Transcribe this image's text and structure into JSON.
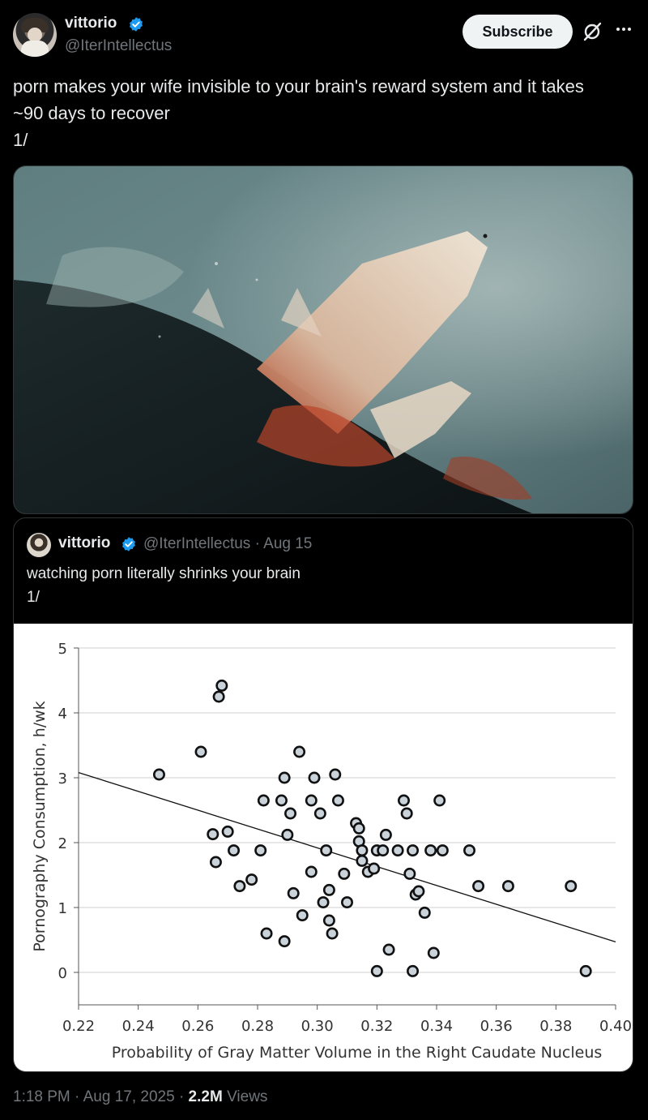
{
  "author": {
    "name": "vittorio",
    "handle": "@IterIntellectus"
  },
  "actions": {
    "subscribe_label": "Subscribe"
  },
  "tweet": {
    "text": "porn makes your wife invisible to your brain's reward system and it takes\n~90 days to recover\n1/"
  },
  "quote": {
    "name": "vittorio",
    "handle": "@IterIntellectus",
    "separator": "·",
    "date": "Aug 15",
    "text": "watching porn literally shrinks your brain\n1/"
  },
  "footer": {
    "time": "1:18 PM",
    "date": "Aug 17, 2025",
    "views_count": "2.2M",
    "views_label": "Views"
  },
  "colors": {
    "verified": "#1d9bf0",
    "marker_fill": "#c9d3d9"
  },
  "icons": [
    "verified-badge-icon",
    "grok-icon",
    "more-icon"
  ],
  "chart_data": {
    "type": "scatter",
    "title": "",
    "xlabel": "Probability of Gray Matter Volume in the Right Caudate Nucleus",
    "ylabel": "Pornography Consumption, h/wk",
    "xlim": [
      0.22,
      0.4
    ],
    "ylim": [
      -0.5,
      5
    ],
    "x_ticks": [
      "0.22",
      "0.24",
      "0.26",
      "0.28",
      "0.30",
      "0.32",
      "0.34",
      "0.36",
      "0.38",
      "0.40"
    ],
    "y_ticks": [
      "0",
      "1",
      "2",
      "3",
      "4",
      "5"
    ],
    "grid": "horizontal",
    "trendline": {
      "x": [
        0.22,
        0.4
      ],
      "y": [
        3.08,
        0.47
      ]
    },
    "points": [
      {
        "x": 0.247,
        "y": 3.05
      },
      {
        "x": 0.261,
        "y": 3.4
      },
      {
        "x": 0.267,
        "y": 4.25
      },
      {
        "x": 0.268,
        "y": 4.42
      },
      {
        "x": 0.265,
        "y": 2.13
      },
      {
        "x": 0.266,
        "y": 1.7
      },
      {
        "x": 0.27,
        "y": 2.17
      },
      {
        "x": 0.272,
        "y": 1.88
      },
      {
        "x": 0.274,
        "y": 1.33
      },
      {
        "x": 0.278,
        "y": 1.43
      },
      {
        "x": 0.281,
        "y": 1.88
      },
      {
        "x": 0.282,
        "y": 2.65
      },
      {
        "x": 0.283,
        "y": 0.6
      },
      {
        "x": 0.288,
        "y": 2.65
      },
      {
        "x": 0.289,
        "y": 3.0
      },
      {
        "x": 0.29,
        "y": 2.12
      },
      {
        "x": 0.289,
        "y": 0.48
      },
      {
        "x": 0.291,
        "y": 2.45
      },
      {
        "x": 0.292,
        "y": 1.22
      },
      {
        "x": 0.294,
        "y": 3.4
      },
      {
        "x": 0.295,
        "y": 0.88
      },
      {
        "x": 0.298,
        "y": 2.65
      },
      {
        "x": 0.298,
        "y": 1.55
      },
      {
        "x": 0.299,
        "y": 3.0
      },
      {
        "x": 0.301,
        "y": 2.45
      },
      {
        "x": 0.302,
        "y": 1.08
      },
      {
        "x": 0.303,
        "y": 1.88
      },
      {
        "x": 0.304,
        "y": 0.8
      },
      {
        "x": 0.304,
        "y": 1.27
      },
      {
        "x": 0.305,
        "y": 0.6
      },
      {
        "x": 0.306,
        "y": 3.05
      },
      {
        "x": 0.307,
        "y": 2.65
      },
      {
        "x": 0.309,
        "y": 1.52
      },
      {
        "x": 0.31,
        "y": 1.08
      },
      {
        "x": 0.313,
        "y": 2.3
      },
      {
        "x": 0.314,
        "y": 2.22
      },
      {
        "x": 0.314,
        "y": 2.02
      },
      {
        "x": 0.315,
        "y": 1.88
      },
      {
        "x": 0.315,
        "y": 1.72
      },
      {
        "x": 0.317,
        "y": 1.55
      },
      {
        "x": 0.319,
        "y": 1.6
      },
      {
        "x": 0.32,
        "y": 1.88
      },
      {
        "x": 0.322,
        "y": 1.88
      },
      {
        "x": 0.323,
        "y": 2.12
      },
      {
        "x": 0.32,
        "y": 0.02
      },
      {
        "x": 0.324,
        "y": 0.35
      },
      {
        "x": 0.327,
        "y": 1.88
      },
      {
        "x": 0.329,
        "y": 2.65
      },
      {
        "x": 0.33,
        "y": 2.45
      },
      {
        "x": 0.331,
        "y": 1.52
      },
      {
        "x": 0.332,
        "y": 1.88
      },
      {
        "x": 0.333,
        "y": 1.2
      },
      {
        "x": 0.334,
        "y": 1.25
      },
      {
        "x": 0.336,
        "y": 0.92
      },
      {
        "x": 0.332,
        "y": 0.02
      },
      {
        "x": 0.338,
        "y": 1.88
      },
      {
        "x": 0.341,
        "y": 2.65
      },
      {
        "x": 0.342,
        "y": 1.88
      },
      {
        "x": 0.339,
        "y": 0.3
      },
      {
        "x": 0.351,
        "y": 1.88
      },
      {
        "x": 0.354,
        "y": 1.33
      },
      {
        "x": 0.364,
        "y": 1.33
      },
      {
        "x": 0.385,
        "y": 1.33
      },
      {
        "x": 0.39,
        "y": 0.02
      }
    ]
  }
}
